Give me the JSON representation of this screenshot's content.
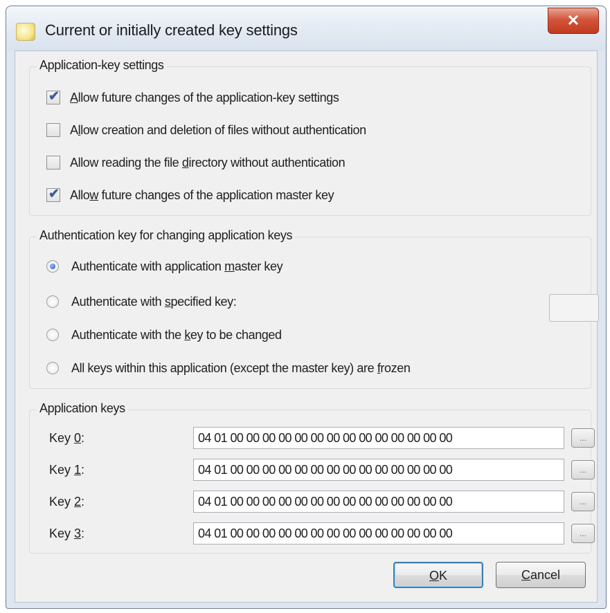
{
  "window": {
    "title": "Current or initially created key settings",
    "close_glyph": "✕"
  },
  "app_key_settings": {
    "title": "Application-key settings",
    "options": [
      {
        "label_pre": "",
        "mnemonic": "A",
        "label_post": "llow future changes of the application-key settings",
        "checked": true
      },
      {
        "label_pre": "A",
        "mnemonic": "l",
        "label_post": "low creation and deletion of files without authentication",
        "checked": false
      },
      {
        "label_pre": "Allow reading the file ",
        "mnemonic": "d",
        "label_post": "irectory without authentication",
        "checked": false
      },
      {
        "label_pre": "Allo",
        "mnemonic": "w",
        "label_post": " future changes of the application master key",
        "checked": true
      }
    ]
  },
  "auth_key": {
    "title": "Authentication key for changing application keys",
    "options": [
      {
        "label_pre": "Authenticate with application ",
        "mnemonic": "m",
        "label_post": "aster key",
        "selected": true
      },
      {
        "label_pre": "Authenticate with ",
        "mnemonic": "s",
        "label_post": "pecified key:",
        "selected": false
      },
      {
        "label_pre": "Authenticate with the ",
        "mnemonic": "k",
        "label_post": "ey to be changed",
        "selected": false
      },
      {
        "label_pre": "All keys within this application (except the master key) are ",
        "mnemonic": "f",
        "label_post": "rozen",
        "selected": false
      }
    ]
  },
  "app_keys": {
    "title": "Application keys",
    "keys": [
      {
        "label_pre": "Key ",
        "mnemonic": "0",
        "label_post": ":",
        "value": "04 01 00 00 00 00 00 00 00 00 00 00 00 00 00 00",
        "button": "..."
      },
      {
        "label_pre": "Key ",
        "mnemonic": "1",
        "label_post": ":",
        "value": "04 01 00 00 00 00 00 00 00 00 00 00 00 00 00 00",
        "button": "..."
      },
      {
        "label_pre": "Key ",
        "mnemonic": "2",
        "label_post": ":",
        "value": "04 01 00 00 00 00 00 00 00 00 00 00 00 00 00 00",
        "button": "..."
      },
      {
        "label_pre": "Key ",
        "mnemonic": "3",
        "label_post": ":",
        "value": "04 01 00 00 00 00 00 00 00 00 00 00 00 00 00 00",
        "button": "..."
      }
    ]
  },
  "buttons": {
    "ok_mnemonic": "O",
    "ok_rest": "K",
    "cancel_mnemonic": "C",
    "cancel_rest": "ancel"
  },
  "icons": {
    "checkbox_check": "✔"
  }
}
